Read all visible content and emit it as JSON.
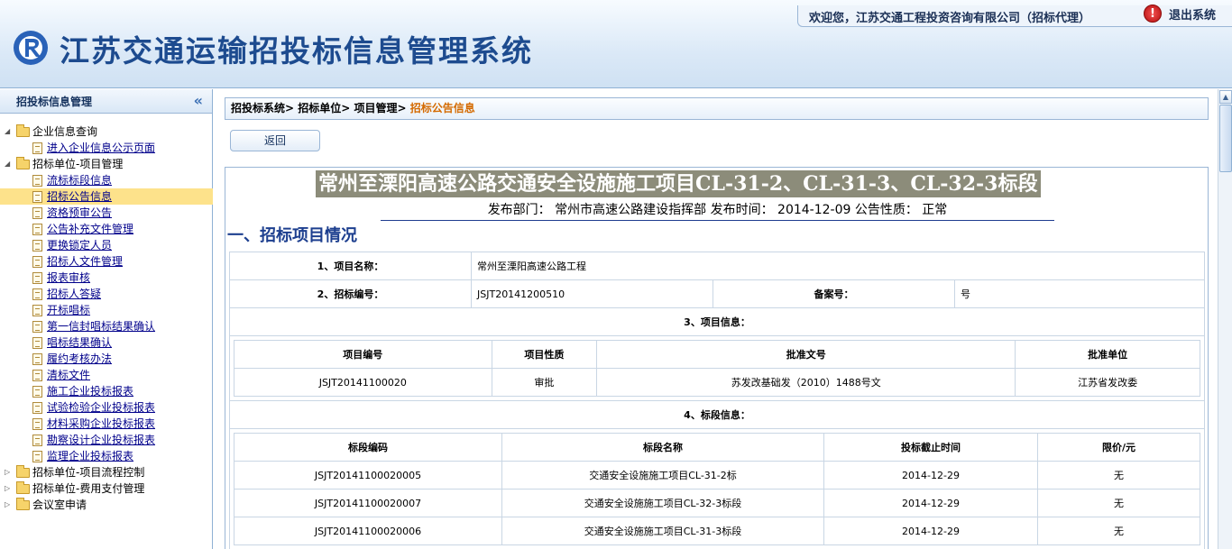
{
  "header": {
    "app_title": "江苏交通运输招投标信息管理系统",
    "welcome": "欢迎您，江苏交通工程投资咨询有限公司（招标代理）",
    "logout_label": "退出系统",
    "logout_icon_glyph": "!"
  },
  "sidebar": {
    "title": "招投标信息管理",
    "collapse_glyph": "«",
    "groups": [
      {
        "label": "企业信息查询",
        "expanded": true,
        "items": [
          "进入企业信息公示页面"
        ]
      },
      {
        "label": "招标单位-项目管理",
        "expanded": true,
        "items": [
          "流标标段信息",
          "招标公告信息",
          "资格预审公告",
          "公告补充文件管理",
          "更换锁定人员",
          "招标人文件管理",
          "报表审核",
          "招标人答疑",
          "开标唱标",
          "第一信封唱标结果确认",
          "唱标结果确认",
          "履约考核办法",
          "清标文件",
          "施工企业投标报表",
          "试验检验企业投标报表",
          "材料采购企业投标报表",
          "勘察设计企业投标报表",
          "监理企业投标报表"
        ]
      },
      {
        "label": "招标单位-项目流程控制",
        "expanded": false,
        "items": []
      },
      {
        "label": "招标单位-费用支付管理",
        "expanded": false,
        "items": []
      },
      {
        "label": "会议室申请",
        "expanded": false,
        "items": []
      }
    ],
    "selected_item": "招标公告信息"
  },
  "breadcrumb": {
    "items": [
      "招投标系统>",
      "招标单位>",
      "项目管理>"
    ],
    "current": "招标公告信息"
  },
  "back_button": "返回",
  "document": {
    "title": "常州至溧阳高速公路交通安全设施施工项目CL-31-2、CL-31-3、CL-32-3标段",
    "publish_line": "发布部门： 常州市高速公路建设指挥部 发布时间： 2014-12-09 公告性质： 正常",
    "section1": "一、招标项目情况",
    "project_name_label": "1、项目名称：",
    "project_name": "常州至溧阳高速公路工程",
    "tender_no_label": "2、招标编号：",
    "tender_no": "JSJT20141200510",
    "filing_no_label": "备案号：",
    "filing_no": "号",
    "project_info_label": "3、项目信息：",
    "project_info_headers": [
      "项目编号",
      "项目性质",
      "批准文号",
      "批准单位"
    ],
    "project_info_row": [
      "JSJT20141100020",
      "审批",
      "苏发改基础发（2010）1488号文",
      "江苏省发改委"
    ],
    "bid_info_label": "4、标段信息：",
    "bid_headers": [
      "标段编码",
      "标段名称",
      "投标截止时间",
      "限价/元"
    ],
    "bid_rows": [
      [
        "JSJT20141100020005",
        "交通安全设施施工项目CL-31-2标",
        "2014-12-29",
        "无"
      ],
      [
        "JSJT20141100020007",
        "交通安全设施施工项目CL-32-3标段",
        "2014-12-29",
        "无"
      ],
      [
        "JSJT20141100020006",
        "交通安全设施施工项目CL-31-3标段",
        "2014-12-29",
        "无"
      ]
    ]
  },
  "colors": {
    "title_blue": "#1d4b8f",
    "current_crumb": "#d46a00",
    "selected_row": "#fde28b",
    "link": "#00008b"
  }
}
